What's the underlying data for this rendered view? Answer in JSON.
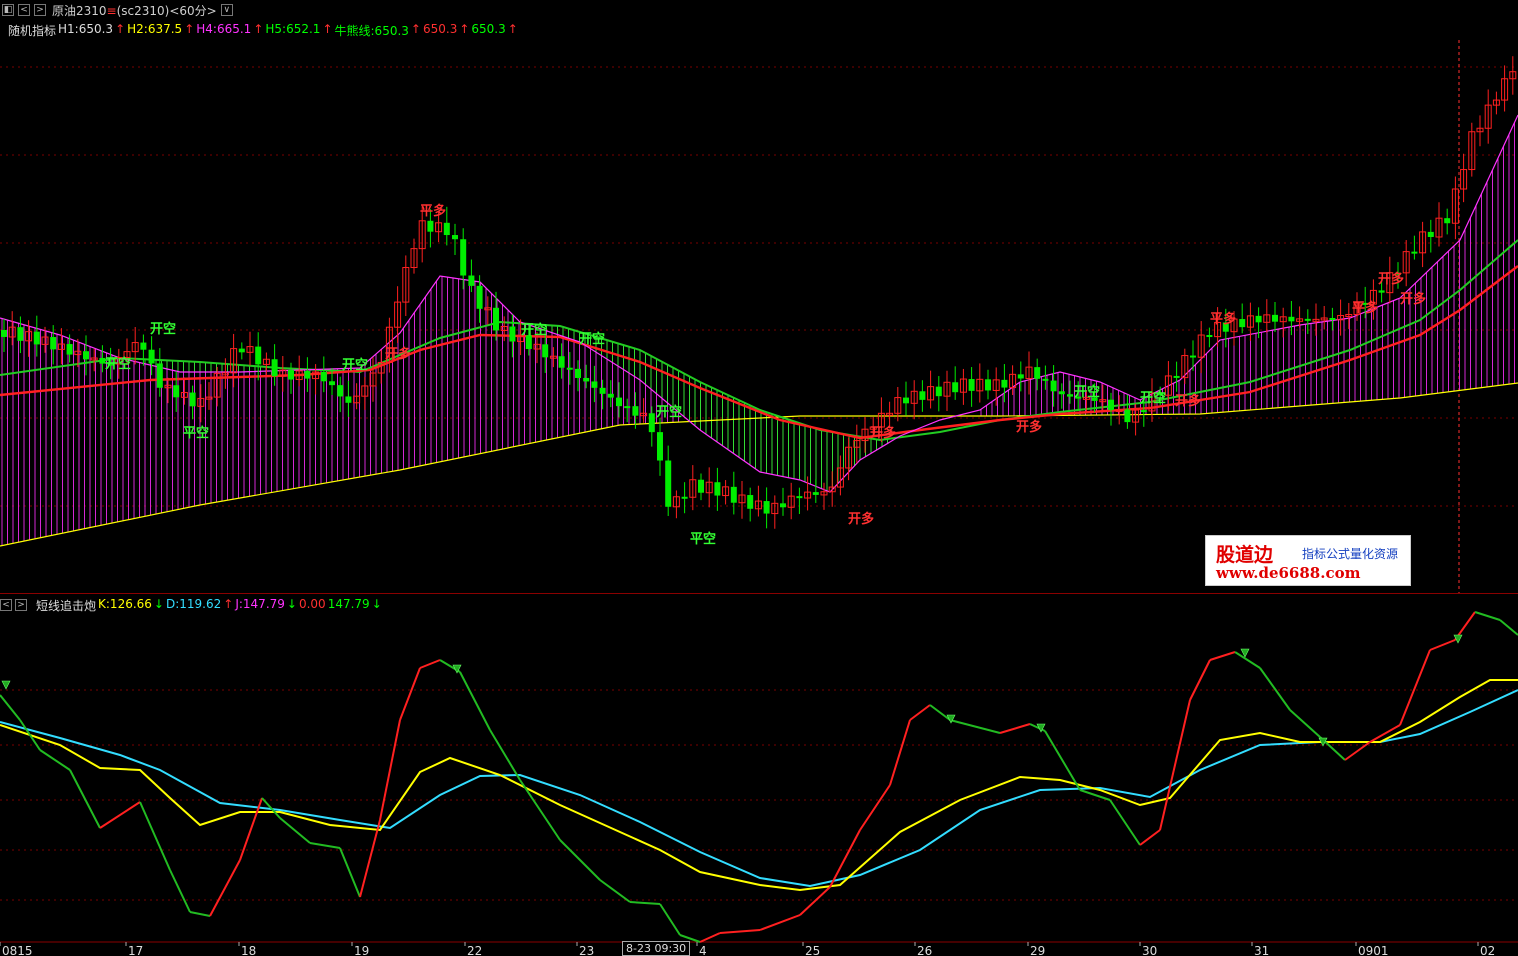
{
  "toolbar": {
    "symbol_label": "原油2310",
    "symbol_mark": "≡",
    "code_period": "(sc2310)<60分>",
    "buttons": [
      "◧",
      "<",
      ">",
      "∨"
    ]
  },
  "main_legend": [
    {
      "text": "随机指标",
      "color": "#dddddd"
    },
    {
      "text": "H1:650.3",
      "color": "#dddddd"
    },
    {
      "text": "↑",
      "color": "#ff3030"
    },
    {
      "text": "H2:637.5",
      "color": "#ffff00"
    },
    {
      "text": "↑",
      "color": "#ff3030"
    },
    {
      "text": "H4:665.1",
      "color": "#ff33ff"
    },
    {
      "text": "↑",
      "color": "#ff3030"
    },
    {
      "text": "H5:652.1",
      "color": "#00ff00"
    },
    {
      "text": "↑",
      "color": "#ff3030"
    },
    {
      "text": "牛熊线:650.3",
      "color": "#00ff00"
    },
    {
      "text": "↑",
      "color": "#ff3030"
    },
    {
      "text": "650.3",
      "color": "#ff3030"
    },
    {
      "text": "↑",
      "color": "#ff3030"
    },
    {
      "text": "650.3",
      "color": "#00ff00"
    },
    {
      "text": "↑",
      "color": "#ff3030"
    }
  ],
  "sub_legend": [
    {
      "text": "短线追击炮",
      "color": "#dddddd"
    },
    {
      "text": "K:126.66",
      "color": "#ffff00"
    },
    {
      "text": "↓",
      "color": "#00ff00"
    },
    {
      "text": "D:119.62",
      "color": "#33ddff"
    },
    {
      "text": "↑",
      "color": "#ff3030"
    },
    {
      "text": "J:147.79",
      "color": "#ff33ff"
    },
    {
      "text": "↓",
      "color": "#00ff00"
    },
    {
      "text": "0.00",
      "color": "#ff3030"
    },
    {
      "text": "147.79",
      "color": "#00ff00"
    },
    {
      "text": "↓",
      "color": "#00ff00"
    }
  ],
  "signals": [
    {
      "text": "开空",
      "color": "#33ff33"
    },
    {
      "text": "开空",
      "color": "#33ff33"
    },
    {
      "text": "平空",
      "color": "#33ff33"
    },
    {
      "text": "开空",
      "color": "#33ff33"
    },
    {
      "text": "平多",
      "color": "#ff3030"
    },
    {
      "text": "开多",
      "color": "#ff3030"
    },
    {
      "text": "开空",
      "color": "#33ff33"
    },
    {
      "text": "开空",
      "color": "#33ff33"
    },
    {
      "text": "开空",
      "color": "#33ff33"
    },
    {
      "text": "平空",
      "color": "#33ff33"
    },
    {
      "text": "开多",
      "color": "#ff3030"
    },
    {
      "text": "开多",
      "color": "#ff3030"
    },
    {
      "text": "开多",
      "color": "#ff3030"
    },
    {
      "text": "开空",
      "color": "#33ff33"
    },
    {
      "text": "开空",
      "color": "#33ff33"
    },
    {
      "text": "开多",
      "color": "#ff3030"
    },
    {
      "text": "平多",
      "color": "#ff3030"
    },
    {
      "text": "开多",
      "color": "#ff3030"
    },
    {
      "text": "平多",
      "color": "#ff3030"
    },
    {
      "text": "开多",
      "color": "#ff3030"
    }
  ],
  "x_axis_labels": [
    "0815",
    "17",
    "18",
    "19",
    "22",
    "23",
    "8-23 09:30",
    "4",
    "25",
    "26",
    "29",
    "30",
    "31",
    "0901",
    "02"
  ],
  "cursor_time": "8-23 09:30",
  "watermark": {
    "brand": "股道边",
    "tagline": "指标公式量化资源",
    "url": "www.de6688.com"
  },
  "colors": {
    "background": "#000000",
    "up": "#ff2020",
    "down": "#00ee00",
    "ma_red": "#ff2020",
    "ma_green": "#22cc22",
    "line_yellow": "#ffff00",
    "line_cyan": "#33ddff",
    "line_magenta": "#ff33ff",
    "grid": "#7a0000"
  }
}
